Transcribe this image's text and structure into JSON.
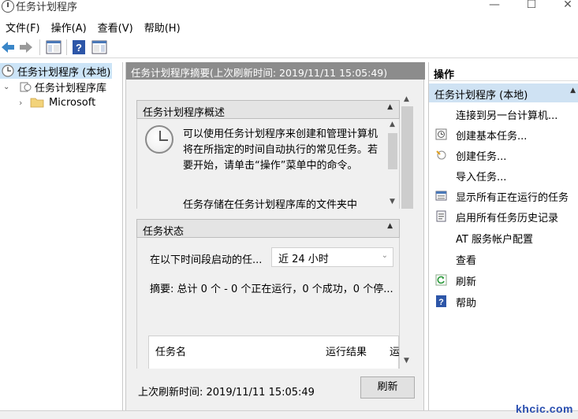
{
  "window": {
    "title": "任务计划程序",
    "min_glyph": "—",
    "max_glyph": "☐",
    "close_glyph": "✕"
  },
  "menu": [
    "文件(F)",
    "操作(A)",
    "查看(V)",
    "帮助(H)"
  ],
  "tree": {
    "root": "任务计划程序 (本地)",
    "library": "任务计划程序库",
    "child": "Microsoft"
  },
  "center": {
    "header": "任务计划程序摘要(上次刷新时间: 2019/11/11 15:05:49)",
    "overview_title": "任务计划程序概述",
    "overview_text": "可以使用任务计划程序来创建和管理计算机将在所指定的时间自动执行的常见任务。若要开始，请单击“操作”菜单中的命令。",
    "overview_text2": "任务存储在任务计划程序库的文件夹中",
    "status_title": "任务状态",
    "status_label": "在以下时间段启动的任...",
    "period_value": "近 24 小时",
    "summary": "摘要: 总计 0 个 - 0 个正在运行，0 个成功，0 个停...",
    "table_headers": [
      "任务名",
      "运行结果",
      "运"
    ],
    "last_refresh": "上次刷新时间: 2019/11/11 15:05:49",
    "refresh_button": "刷新"
  },
  "actions": {
    "title": "操作",
    "group": "任务计划程序 (本地)",
    "items": [
      {
        "label": "连接到另一台计算机...",
        "icon": "none"
      },
      {
        "label": "创建基本任务...",
        "icon": "basic-task-icon"
      },
      {
        "label": "创建任务...",
        "icon": "create-task-icon"
      },
      {
        "label": "导入任务...",
        "icon": "none"
      },
      {
        "label": "显示所有正在运行的任务",
        "icon": "running-tasks-icon"
      },
      {
        "label": "启用所有任务历史记录",
        "icon": "history-icon"
      },
      {
        "label": "AT 服务帐户配置",
        "icon": "none"
      },
      {
        "label": "查看",
        "icon": "none"
      },
      {
        "label": "刷新",
        "icon": "refresh-icon"
      },
      {
        "label": "帮助",
        "icon": "help-icon"
      }
    ]
  },
  "watermark": "khcic.com",
  "colors": {
    "header_bg": "#8c8c8c",
    "selected_bg": "#cce4f7",
    "action_group_bg": "#cfe2f3",
    "help_blue": "#2d56a8"
  }
}
